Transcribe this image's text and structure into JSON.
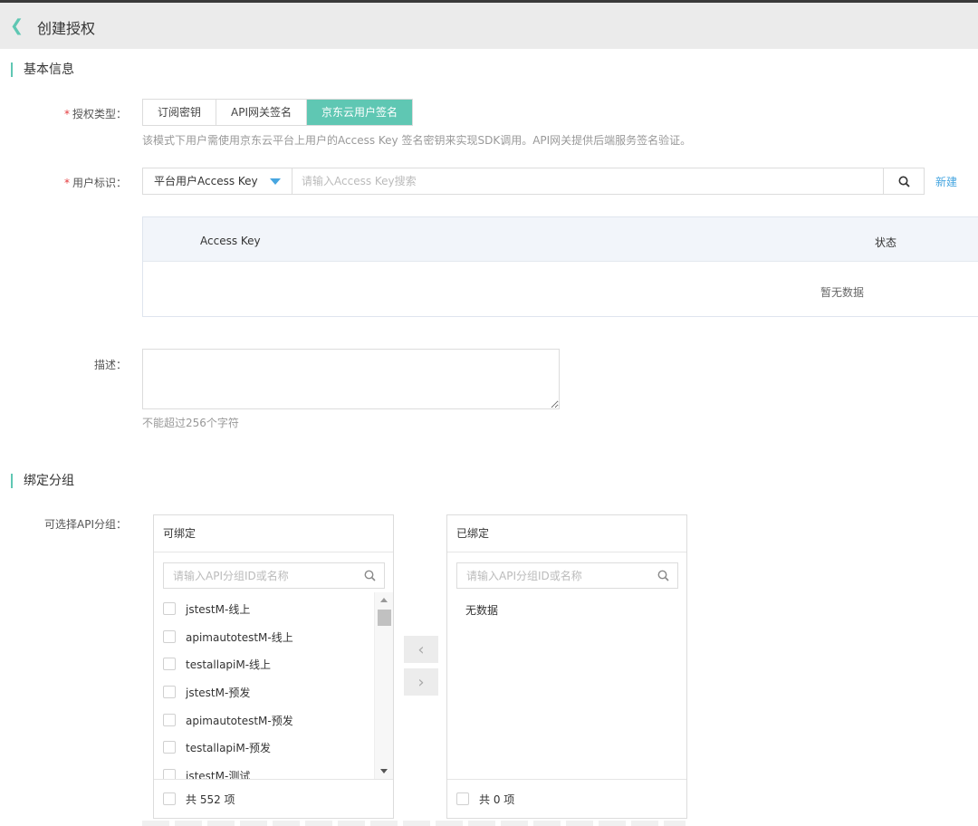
{
  "header": {
    "title": "创建授权"
  },
  "basic_section": {
    "title": "基本信息"
  },
  "auth_type": {
    "label": "授权类型：",
    "options": [
      "订阅密钥",
      "API网关签名",
      "京东云用户签名"
    ],
    "selected": "京东云用户签名",
    "hint": "该模式下用户需使用京东云平台上用户的Access Key 签名密钥来实现SDK调用。API网关提供后端服务签名验证。"
  },
  "user_id": {
    "label": "用户标识：",
    "select_value": "平台用户Access Key",
    "placeholder": "请输入Access Key搜索",
    "new_link": "新建"
  },
  "key_table": {
    "columns": [
      "Access Key",
      "状态"
    ],
    "empty_text": "暂无数据"
  },
  "description": {
    "label": "描述：",
    "hint": "不能超过256个字符"
  },
  "bind_section": {
    "title": "绑定分组"
  },
  "api_groups": {
    "label": "可选择API分组：",
    "available": {
      "title": "可绑定",
      "placeholder": "请输入API分组ID或名称",
      "items": [
        "jstestM-线上",
        "apimautotestM-线上",
        "testallapiM-线上",
        "jstestM-预发",
        "apimautotestM-预发",
        "testallapiM-预发",
        "jstestM-测试"
      ],
      "count_text": "共 552 项"
    },
    "bound": {
      "title": "已绑定",
      "placeholder": "请输入API分组ID或名称",
      "empty_text": "无数据",
      "count_text": "共 0 项"
    }
  },
  "colors": {
    "accent": "#5fc7b3",
    "link": "#47a6e0",
    "required": "#e4393c"
  }
}
